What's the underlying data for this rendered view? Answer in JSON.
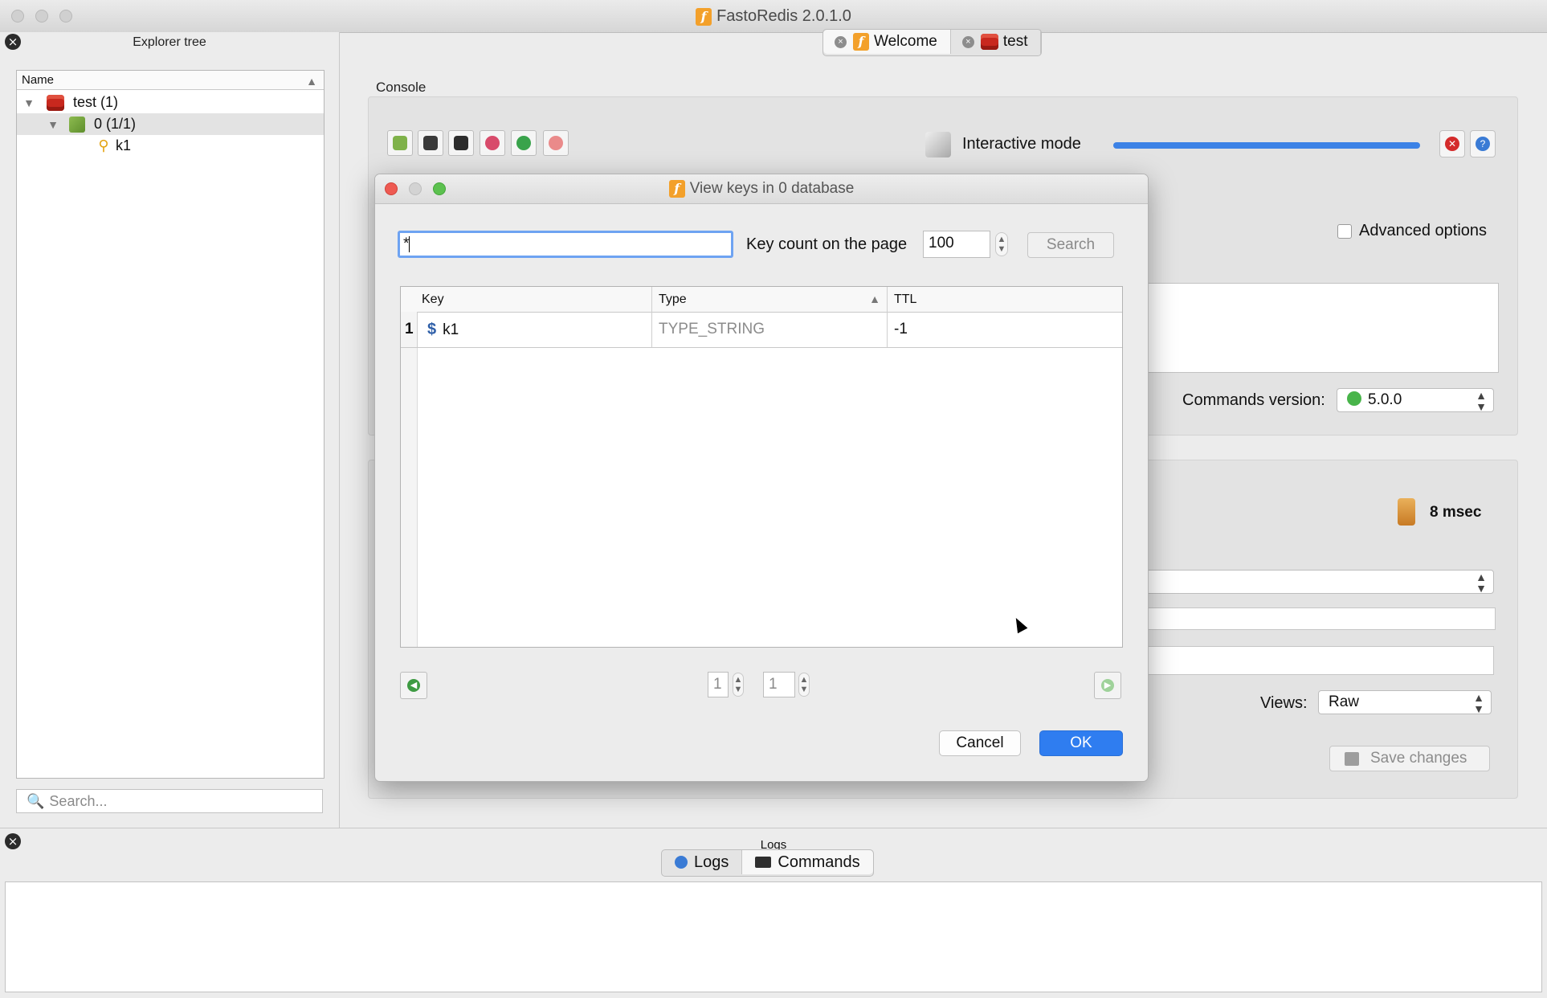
{
  "window": {
    "title": "FastoRedis 2.0.1.0"
  },
  "explorer": {
    "title": "Explorer tree",
    "column_header": "Name",
    "items": [
      {
        "label": "test (1)",
        "icon": "redis-server-icon"
      },
      {
        "label": "0 (1/1)",
        "icon": "database-icon"
      },
      {
        "label": "k1",
        "icon": "key-icon"
      }
    ],
    "search_placeholder": "Search..."
  },
  "tabs": [
    {
      "label": "Welcome",
      "icon": "fasto-logo-icon",
      "active": true
    },
    {
      "label": "test",
      "icon": "redis-server-icon",
      "active": false
    }
  ],
  "console": {
    "label": "Console",
    "interactive_mode_label": "Interactive mode",
    "advanced_options_label": "Advanced options",
    "advanced_options_checked": false,
    "commands_version_label": "Commands version:",
    "commands_version_value": "5.0.0",
    "exec_time": "8 msec",
    "views_label": "Views:",
    "views_value": "Raw",
    "save_changes_label": "Save changes"
  },
  "dialog": {
    "title": "View keys in 0 database",
    "pattern_value": "*",
    "key_count_label": "Key count on the page",
    "key_count_value": "100",
    "search_button": "Search",
    "table": {
      "columns": [
        "Key",
        "Type",
        "TTL"
      ],
      "sorted_column": "Type",
      "rows": [
        {
          "index": "1",
          "key": "k1",
          "type": "TYPE_STRING",
          "ttl": "-1"
        }
      ]
    },
    "pagination": {
      "current_page": "1",
      "total_pages": "1"
    },
    "cancel_button": "Cancel",
    "ok_button": "OK"
  },
  "logs": {
    "title": "Logs",
    "tabs": [
      {
        "label": "Logs",
        "active": false
      },
      {
        "label": "Commands",
        "active": true
      }
    ]
  },
  "colors": {
    "accent_blue": "#3c82e6",
    "ok_button": "#2f7df0",
    "redis_red": "#c8281e",
    "fasto_orange": "#f3a02a"
  }
}
